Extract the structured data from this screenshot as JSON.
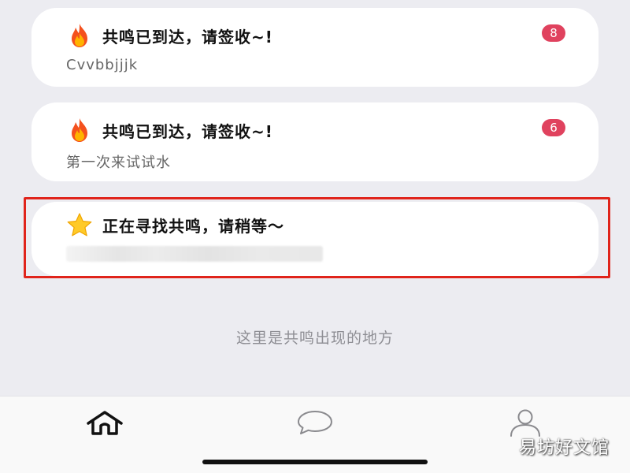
{
  "notifications": [
    {
      "icon": "fire-icon",
      "title": "共鸣已到达，请签收~!",
      "subtitle": "Cvvbbjjjk",
      "badge": "8"
    },
    {
      "icon": "fire-icon",
      "title": "共鸣已到达，请签收~!",
      "subtitle": "第一次来试试水",
      "badge": "6"
    },
    {
      "icon": "star-icon",
      "title": "正在寻找共鸣，请稍等～"
    }
  ],
  "empty_hint": "这里是共鸣出现的地方",
  "tabbar": {
    "tabs": [
      {
        "icon": "home-icon"
      },
      {
        "icon": "chat-bubble-icon"
      },
      {
        "icon": "user-icon"
      }
    ]
  },
  "watermark": "易坊好文馆",
  "colors": {
    "badge": "#e0425e",
    "highlight_border": "#e0241b",
    "background": "#ececf1"
  }
}
